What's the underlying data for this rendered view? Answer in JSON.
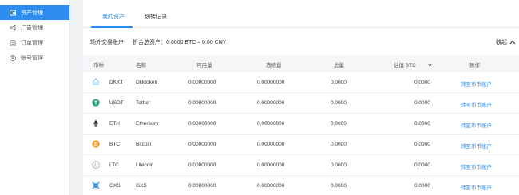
{
  "sidebar": {
    "items": [
      {
        "label": "资产管理",
        "icon": "asset-icon",
        "active": true
      },
      {
        "label": "广告管理",
        "icon": "megaphone-icon"
      },
      {
        "label": "订单管理",
        "icon": "clipboard-icon"
      },
      {
        "label": "账号管理",
        "icon": "user-icon"
      }
    ]
  },
  "tabs": [
    {
      "label": "我的资产",
      "active": true
    },
    {
      "label": "划转记录"
    }
  ],
  "account": {
    "name": "场外交易账户",
    "total": "折合总资产：0.0000 BTC ≈ 0.00 CNY",
    "collapse": "收起"
  },
  "table": {
    "headers": [
      "币种",
      "名称",
      "可用量",
      "冻结量",
      "总量",
      "估值 BTC",
      "操作"
    ],
    "rows": [
      {
        "symbol": "DKKT",
        "name": "Dkktoken",
        "available": "0.00000000",
        "frozen": "0.00000000",
        "total": "0.0000",
        "btc": "0.0000",
        "action": "转至币币账户",
        "icon": "dkkt-icon",
        "color": "#5ab4f0"
      },
      {
        "symbol": "USDT",
        "name": "Tether",
        "available": "0.00000000",
        "frozen": "0.00000000",
        "total": "0.0000",
        "btc": "0.0000",
        "action": "转至币币账户",
        "icon": "usdt-icon",
        "color": "#26a17b"
      },
      {
        "symbol": "ETH",
        "name": "Ethereum",
        "available": "0.00000000",
        "frozen": "0.00000000",
        "total": "0.0000",
        "btc": "0.0000",
        "action": "转至币币账户",
        "icon": "eth-icon",
        "color": "#3c3c3d"
      },
      {
        "symbol": "BTC",
        "name": "Bitcoin",
        "available": "0.00000000",
        "frozen": "0.00000000",
        "total": "0.0000",
        "btc": "0.0000",
        "action": "转至币币账户",
        "icon": "btc-icon",
        "color": "#f7931a"
      },
      {
        "symbol": "LTC",
        "name": "Litecoin",
        "available": "0.00000000",
        "frozen": "0.00000000",
        "total": "0.0000",
        "btc": "0.0000",
        "action": "转至币币账户",
        "icon": "ltc-icon",
        "color": "#a6a9aa"
      },
      {
        "symbol": "GXS",
        "name": "GXS",
        "available": "0.00000000",
        "frozen": "0.00000000",
        "total": "0.0000",
        "btc": "0.0000",
        "action": "转至币币账户",
        "icon": "gxs-icon",
        "color": "#35a5f7"
      }
    ]
  }
}
